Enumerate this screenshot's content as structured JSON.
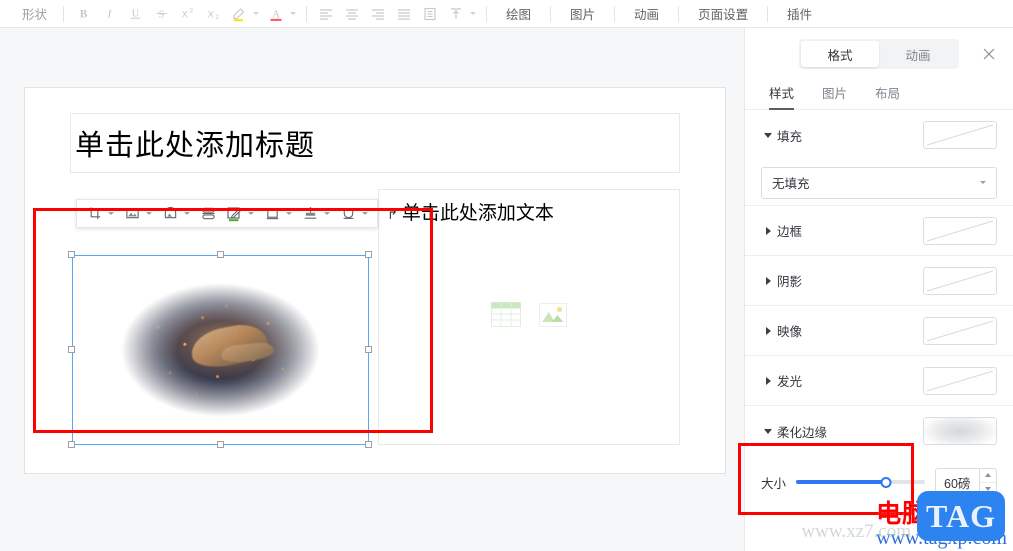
{
  "toolbar": {
    "shape_label": "形状",
    "format_icons": [
      {
        "name": "bold-icon",
        "glyph": "B"
      },
      {
        "name": "italic-icon",
        "glyph": "I"
      },
      {
        "name": "underline-icon",
        "glyph": "U"
      },
      {
        "name": "strikethrough-icon",
        "glyph": "S"
      },
      {
        "name": "superscript-icon",
        "glyph": "X²"
      },
      {
        "name": "subscript-icon",
        "glyph": "X₂"
      },
      {
        "name": "highlight-color-icon",
        "glyph": "highlighter"
      },
      {
        "name": "font-color-icon",
        "glyph": "A"
      }
    ],
    "align_icons": [
      {
        "name": "align-left-icon"
      },
      {
        "name": "align-center-icon"
      },
      {
        "name": "align-right-icon"
      },
      {
        "name": "align-justify-icon"
      },
      {
        "name": "line-spacing-icon"
      },
      {
        "name": "vertical-align-icon"
      }
    ],
    "menus": [
      {
        "label": "绘图",
        "name": "menu-draw"
      },
      {
        "label": "图片",
        "name": "menu-picture"
      },
      {
        "label": "动画",
        "name": "menu-animation"
      },
      {
        "label": "页面设置",
        "name": "menu-page-setup"
      },
      {
        "label": "插件",
        "name": "menu-plugin"
      }
    ]
  },
  "float_toolbar": {
    "items": [
      {
        "name": "crop-icon",
        "has_caret": true
      },
      {
        "name": "picture-frame-icon",
        "has_caret": true
      },
      {
        "name": "picture-shape-icon",
        "has_caret": true
      },
      {
        "name": "flip-icon",
        "has_caret": false
      },
      {
        "name": "pen-edit-icon",
        "has_caret": true
      },
      {
        "name": "picture-border-icon",
        "has_caret": true
      },
      {
        "name": "picture-effects-icon",
        "has_caret": true
      },
      {
        "name": "picture-layout-icon",
        "has_caret": true
      }
    ]
  },
  "slide": {
    "title_placeholder": "单击此处添加标题",
    "body_placeholder": "单击此处添加文本",
    "body_bullet": "↱",
    "content_icons": [
      {
        "name": "insert-table-icon"
      },
      {
        "name": "insert-image-icon"
      }
    ]
  },
  "panel": {
    "segments": [
      {
        "label": "格式",
        "name": "segment-format",
        "active": true
      },
      {
        "label": "动画",
        "name": "segment-animation",
        "active": false
      }
    ],
    "close_icon": "close-icon",
    "tabs": [
      {
        "label": "样式",
        "name": "tab-style",
        "active": true
      },
      {
        "label": "图片",
        "name": "tab-picture",
        "active": false
      },
      {
        "label": "布局",
        "name": "tab-layout",
        "active": false
      }
    ],
    "sections": [
      {
        "label": "填充",
        "name": "section-fill",
        "expanded": true,
        "swatch": "none"
      },
      {
        "label": "边框",
        "name": "section-border",
        "expanded": false,
        "swatch": "none"
      },
      {
        "label": "阴影",
        "name": "section-shadow",
        "expanded": false,
        "swatch": "none"
      },
      {
        "label": "映像",
        "name": "section-reflection",
        "expanded": false,
        "swatch": "none"
      },
      {
        "label": "发光",
        "name": "section-glow",
        "expanded": false,
        "swatch": "none"
      },
      {
        "label": "柔化边缘",
        "name": "section-soft-edges",
        "expanded": true,
        "swatch": "blur"
      }
    ],
    "fill_select_value": "无填充",
    "soft_edges": {
      "size_label": "大小",
      "value": "60磅",
      "slider_percent": 70
    }
  },
  "watermark": {
    "site_cn": "电脑技术网",
    "site_url": "www.tagxp.com",
    "logo": "TAG",
    "ghost_url": "www.xz7.com"
  },
  "colors": {
    "accent_blue": "#2d78f4",
    "selection_blue": "#5ba7f7",
    "annotation_red": "#ff0000",
    "panel_bg": "#ffffff",
    "canvas_bg": "#f6f7f9"
  }
}
